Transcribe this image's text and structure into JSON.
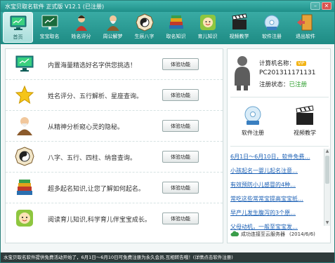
{
  "window": {
    "title": "水宝贝取名软件  正式版 V12.1  (已注册)"
  },
  "toolbar": {
    "items": [
      {
        "label": "首页",
        "icon": "home-monitor-icon"
      },
      {
        "label": "宝宝取名",
        "icon": "baby-naming-board-icon"
      },
      {
        "label": "姓名评分",
        "icon": "name-score-person-icon"
      },
      {
        "label": "周公解梦",
        "icon": "dream-sage-icon"
      },
      {
        "label": "生辰八字",
        "icon": "bagua-icon"
      },
      {
        "label": "取名知识",
        "icon": "books-icon"
      },
      {
        "label": "育儿知识",
        "icon": "childcare-face-icon"
      },
      {
        "label": "视频教学",
        "icon": "clapperboard-icon"
      },
      {
        "label": "软件注册",
        "icon": "register-disc-icon"
      },
      {
        "label": "退出软件",
        "icon": "exit-door-icon"
      }
    ]
  },
  "features": [
    {
      "text": "内置海量精选好名字供您挑选！",
      "button": "体验功能",
      "icon": "monitor-icon"
    },
    {
      "text": "姓名评分、五行解析、星座查询。",
      "button": "体验功能",
      "icon": "star-icon"
    },
    {
      "text": "从精神分析窥心灵的隐秘。",
      "button": "体验功能",
      "icon": "sage-icon"
    },
    {
      "text": "八字、五行、四柱、纳音查询。",
      "button": "体验功能",
      "icon": "bagua-icon"
    },
    {
      "text": "超多起名知识,让您了解如何起名。",
      "button": "体验功能",
      "icon": "books-icon"
    },
    {
      "text": "阅读育儿知识,科学育儿伴宝宝成长。",
      "button": "体验功能",
      "icon": "childcare-icon"
    }
  ],
  "account": {
    "computer_label": "计算机名称：",
    "vip_badge": "VIP",
    "computer_name": "PC201311171131",
    "status_label": "注册状态：",
    "status_value": "已注册"
  },
  "actions": {
    "register_label": "软件注册",
    "video_label": "视频教学"
  },
  "news": [
    "6月1日～6月10日，软件免费…",
    "小孩起名一婴儿起名注意…",
    "有效预防小儿感冒的4种…",
    "常吃这些常常宝提高宝宝抵…",
    "早产儿发生腹泻的3个原…",
    "父母动机，一般至宝宝发…"
  ],
  "connection": {
    "status": "成功连接至云服务器",
    "date": "(2014/6/6)"
  },
  "statusbar": {
    "text": "水宝贝取名软件提供免费活动开始了，6月1日～6月10日可免费注册为永久会员,互相转告哦！(详情点击软件注册)"
  },
  "colors": {
    "accent": "#1f8f88",
    "link": "#1a5fb4",
    "registered": "#2a9d2a"
  }
}
